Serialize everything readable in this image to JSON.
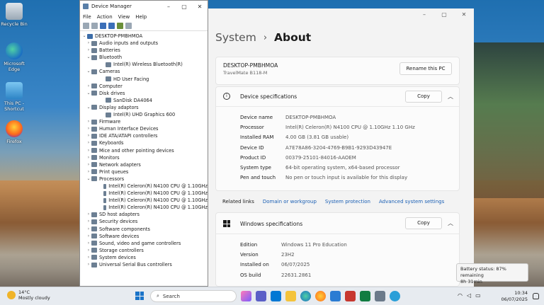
{
  "desktop": {
    "icons": [
      {
        "label": "Recycle Bin"
      },
      {
        "label": "Microsoft Edge"
      },
      {
        "label": "This PC - Shortcut"
      },
      {
        "label": "Firefox"
      }
    ]
  },
  "device_manager": {
    "title": "Device Manager",
    "menu": [
      "File",
      "Action",
      "View",
      "Help"
    ],
    "tree": [
      {
        "level": 0,
        "exp": "v",
        "label": "DESKTOP-PMBHMOA"
      },
      {
        "level": 1,
        "exp": ">",
        "label": "Audio inputs and outputs"
      },
      {
        "level": 1,
        "exp": ">",
        "label": "Batteries"
      },
      {
        "level": 1,
        "exp": "v",
        "label": "Bluetooth"
      },
      {
        "level": 2,
        "exp": "",
        "label": "Intel(R) Wireless Bluetooth(R)"
      },
      {
        "level": 1,
        "exp": "v",
        "label": "Cameras"
      },
      {
        "level": 2,
        "exp": "",
        "label": "HD User Facing"
      },
      {
        "level": 1,
        "exp": ">",
        "label": "Computer"
      },
      {
        "level": 1,
        "exp": "v",
        "label": "Disk drives"
      },
      {
        "level": 2,
        "exp": "",
        "label": "SanDisk DA4064"
      },
      {
        "level": 1,
        "exp": "v",
        "label": "Display adaptors"
      },
      {
        "level": 2,
        "exp": "",
        "label": "Intel(R) UHD Graphics 600"
      },
      {
        "level": 1,
        "exp": ">",
        "label": "Firmware"
      },
      {
        "level": 1,
        "exp": ">",
        "label": "Human Interface Devices"
      },
      {
        "level": 1,
        "exp": ">",
        "label": "IDE ATA/ATAPI controllers"
      },
      {
        "level": 1,
        "exp": ">",
        "label": "Keyboards"
      },
      {
        "level": 1,
        "exp": ">",
        "label": "Mice and other pointing devices"
      },
      {
        "level": 1,
        "exp": ">",
        "label": "Monitors"
      },
      {
        "level": 1,
        "exp": ">",
        "label": "Network adapters"
      },
      {
        "level": 1,
        "exp": ">",
        "label": "Print queues"
      },
      {
        "level": 1,
        "exp": "v",
        "label": "Processors"
      },
      {
        "level": 2,
        "exp": "",
        "label": "Intel(R) Celeron(R) N4100 CPU @ 1.10GHz"
      },
      {
        "level": 2,
        "exp": "",
        "label": "Intel(R) Celeron(R) N4100 CPU @ 1.10GHz"
      },
      {
        "level": 2,
        "exp": "",
        "label": "Intel(R) Celeron(R) N4100 CPU @ 1.10GHz"
      },
      {
        "level": 2,
        "exp": "",
        "label": "Intel(R) Celeron(R) N4100 CPU @ 1.10GHz"
      },
      {
        "level": 1,
        "exp": ">",
        "label": "SD host adapters"
      },
      {
        "level": 1,
        "exp": ">",
        "label": "Security devices"
      },
      {
        "level": 1,
        "exp": ">",
        "label": "Software components"
      },
      {
        "level": 1,
        "exp": ">",
        "label": "Software devices"
      },
      {
        "level": 1,
        "exp": ">",
        "label": "Sound, video and game controllers"
      },
      {
        "level": 1,
        "exp": ">",
        "label": "Storage controllers"
      },
      {
        "level": 1,
        "exp": ">",
        "label": "System devices"
      },
      {
        "level": 1,
        "exp": ">",
        "label": "Universal Serial Bus controllers"
      }
    ]
  },
  "settings": {
    "breadcrumb_parent": "System",
    "breadcrumb_current": "About",
    "pc_name": "DESKTOP-PMBHMOA",
    "pc_model": "TravelMate B118-M",
    "rename_label": "Rename this PC",
    "device_specs": {
      "title": "Device specifications",
      "copy_label": "Copy",
      "rows": [
        {
          "key": "Device name",
          "value": "DESKTOP-PMBHMOA"
        },
        {
          "key": "Processor",
          "value": "Intel(R) Celeron(R) N4100 CPU @ 1.10GHz   1.10 GHz"
        },
        {
          "key": "Installed RAM",
          "value": "4.00 GB (3.81 GB usable)"
        },
        {
          "key": "Device ID",
          "value": "A7E78A86-3204-4769-B9B1-9293D43947E"
        },
        {
          "key": "Product ID",
          "value": "00379-25101-84016-AAOEM"
        },
        {
          "key": "System type",
          "value": "64-bit operating system, x64-based processor"
        },
        {
          "key": "Pen and touch",
          "value": "No pen or touch input is available for this display"
        }
      ]
    },
    "related": {
      "label": "Related links",
      "links": [
        "Domain or workgroup",
        "System protection",
        "Advanced system settings"
      ]
    },
    "windows_specs": {
      "title": "Windows specifications",
      "copy_label": "Copy",
      "rows": [
        {
          "key": "Edition",
          "value": "Windows 11 Pro Education"
        },
        {
          "key": "Version",
          "value": "23H2"
        },
        {
          "key": "Installed on",
          "value": "06/07/2025"
        },
        {
          "key": "OS build",
          "value": "22631.2861"
        }
      ]
    }
  },
  "taskbar": {
    "weather_temp": "14°C",
    "weather_desc": "Mostly cloudy",
    "search_placeholder": "Search",
    "time": "10:34",
    "date": "06/07/2025",
    "battery_tooltip_line1": "Battery status: 87% remaining",
    "battery_tooltip_line2": "8h 31min"
  },
  "colors": {
    "accent": "#1a5fb4",
    "taskbar": "#e7ebf0"
  }
}
